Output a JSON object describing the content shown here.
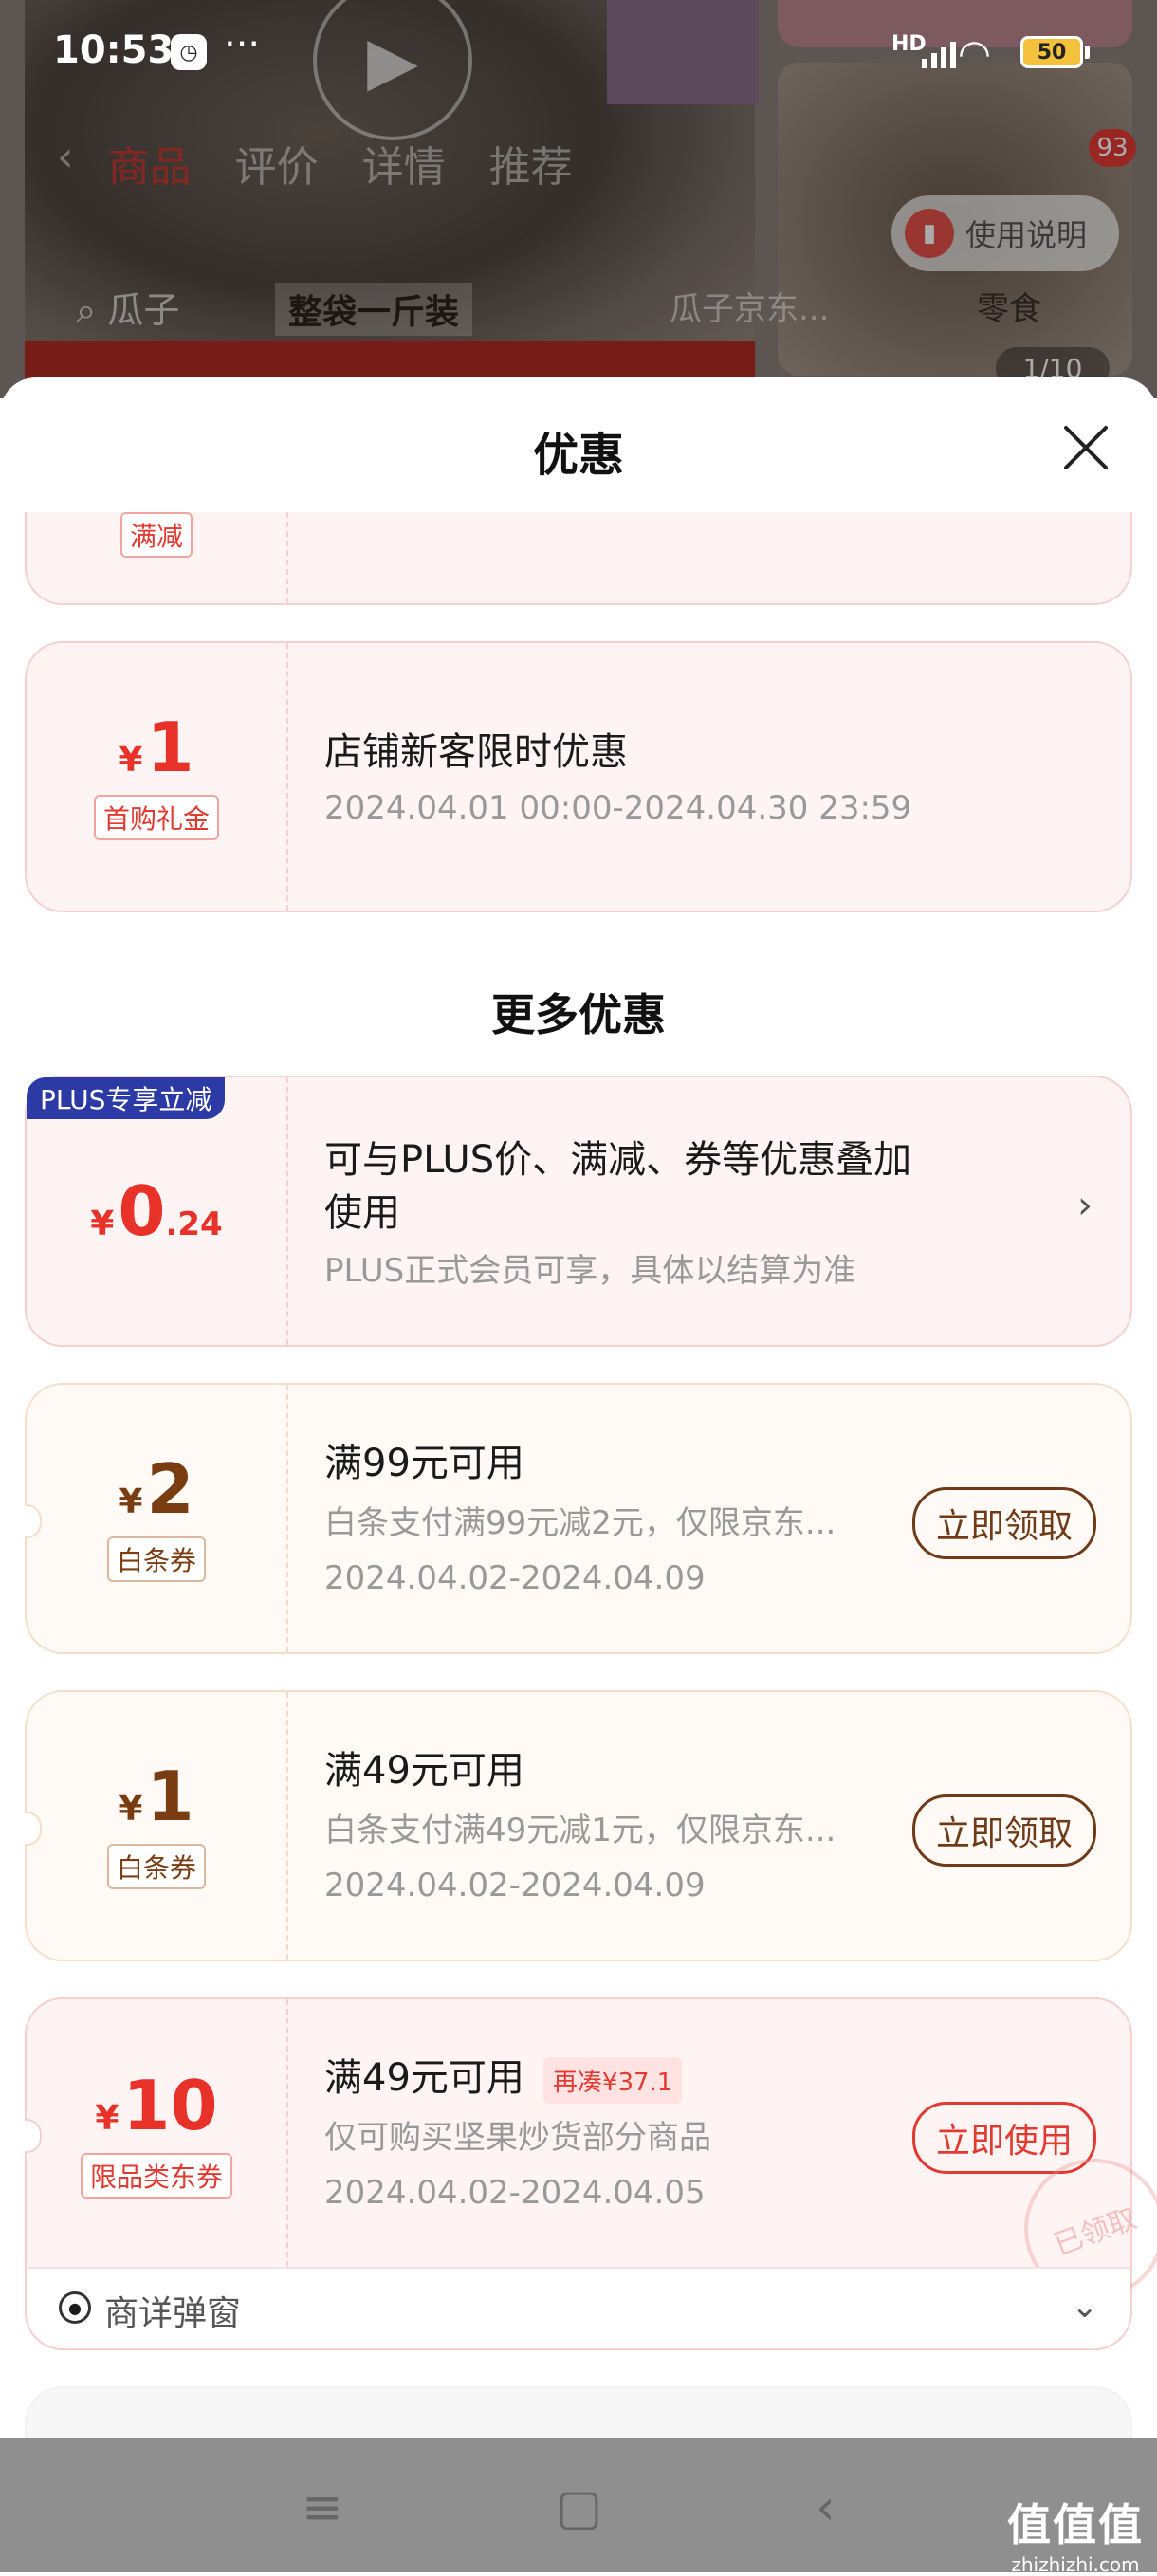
{
  "status_bar": {
    "time": "10:53",
    "network": "HD",
    "battery": "50"
  },
  "background_page": {
    "tabs": [
      "商品",
      "评价",
      "详情",
      "推荐"
    ],
    "help_label": "使用说明",
    "badge_count": "93",
    "search_text": "瓜子",
    "banner_label": "整袋一斤装",
    "related_text": "瓜子京东...",
    "snack_text": "零食",
    "counter": "1/10"
  },
  "sheet": {
    "title": "优惠",
    "top_card": {
      "tag": "满减"
    },
    "store_coupon": {
      "currency": "¥",
      "amount": "1",
      "tag": "首购礼金",
      "title": "店铺新客限时优惠",
      "validity": "2024.04.01 00:00-2024.04.30 23:59"
    },
    "more_title": "更多优惠",
    "plus_offer": {
      "badge": "PLUS专享立减",
      "currency": "¥",
      "amount_int": "0",
      "amount_dec": ".24",
      "title_line1": "可与PLUS价、满减、券等优惠叠加",
      "title_line2": "使用",
      "note": "PLUS正式会员可享，具体以结算为准"
    },
    "coupons": [
      {
        "currency": "¥",
        "amount": "2",
        "tag": "白条券",
        "title": "满99元可用",
        "desc": "白条支付满99元减2元，仅限京东...",
        "validity": "2024.04.02-2024.04.09",
        "button": "立即领取"
      },
      {
        "currency": "¥",
        "amount": "1",
        "tag": "白条券",
        "title": "满49元可用",
        "desc": "白条支付满49元减1元，仅限京东...",
        "validity": "2024.04.02-2024.04.09",
        "button": "立即领取"
      }
    ],
    "category_coupon": {
      "currency": "¥",
      "amount": "10",
      "tag": "限品类东券",
      "title": "满49元可用",
      "extra_badge": "再凑¥37.1",
      "desc": "仅可购买坚果炒货部分商品",
      "validity": "2024.04.02-2024.04.05",
      "button": "立即使用",
      "stamp": "已领取",
      "footer_label": "商详弹窗"
    }
  },
  "watermark": {
    "main": "值值值",
    "sub": "zhizhizhi.com"
  }
}
